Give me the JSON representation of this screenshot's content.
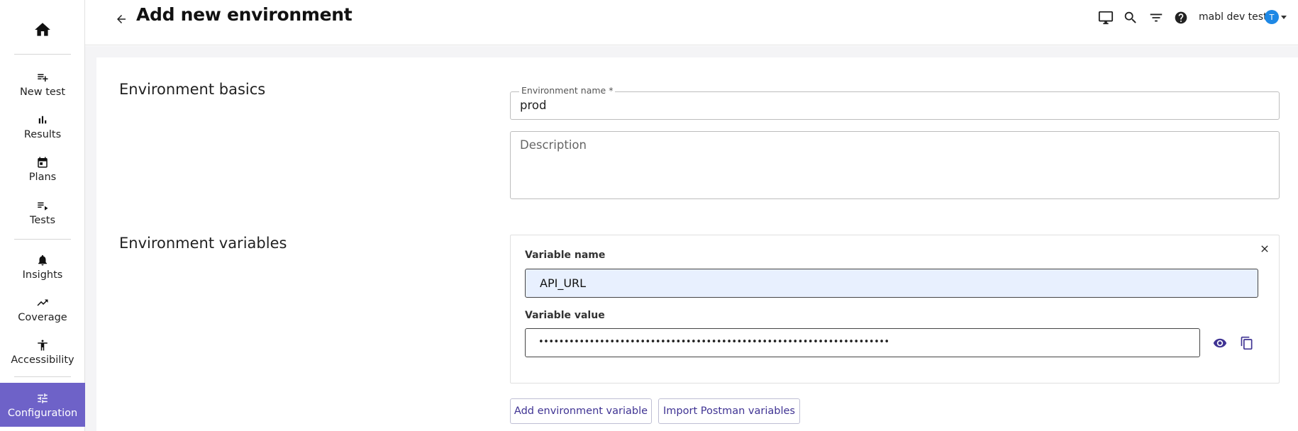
{
  "sidebar": {
    "home_icon": "home-icon",
    "items": [
      {
        "label": "New test",
        "icon": "playlist-add-icon"
      },
      {
        "label": "Results",
        "icon": "bar-chart-icon"
      },
      {
        "label": "Plans",
        "icon": "calendar-icon"
      },
      {
        "label": "Tests",
        "icon": "playlist-play-icon"
      },
      {
        "label": "Insights",
        "icon": "bell-icon"
      },
      {
        "label": "Coverage",
        "icon": "trending-up-icon"
      },
      {
        "label": "Accessibility",
        "icon": "accessibility-icon"
      },
      {
        "label": "Configuration",
        "icon": "tune-icon",
        "active": true
      }
    ]
  },
  "header": {
    "title": "Add new environment",
    "workspace": "mabl dev tests",
    "avatar_initial": "T",
    "icons": [
      "monitor-icon",
      "search-icon",
      "filter-icon",
      "help-icon"
    ]
  },
  "basics": {
    "section_title": "Environment basics",
    "name_label": "Environment name *",
    "name_value": "prod",
    "description_placeholder": "Description"
  },
  "variables": {
    "section_title": "Environment variables",
    "variable_name_label": "Variable name",
    "variable_name_value": "API_URL",
    "variable_value_label": "Variable value",
    "variable_value_masked": "•••••••••••••••••••••••••••••••••••••••••••••••••••••••••••••••••••••",
    "add_button": "Add environment variable",
    "import_button": "Import Postman variables"
  },
  "colors": {
    "accent": "#6e62c8",
    "link": "#3f3393",
    "avatar": "#1e88e5",
    "highlight_field": "#e8f0fe"
  }
}
